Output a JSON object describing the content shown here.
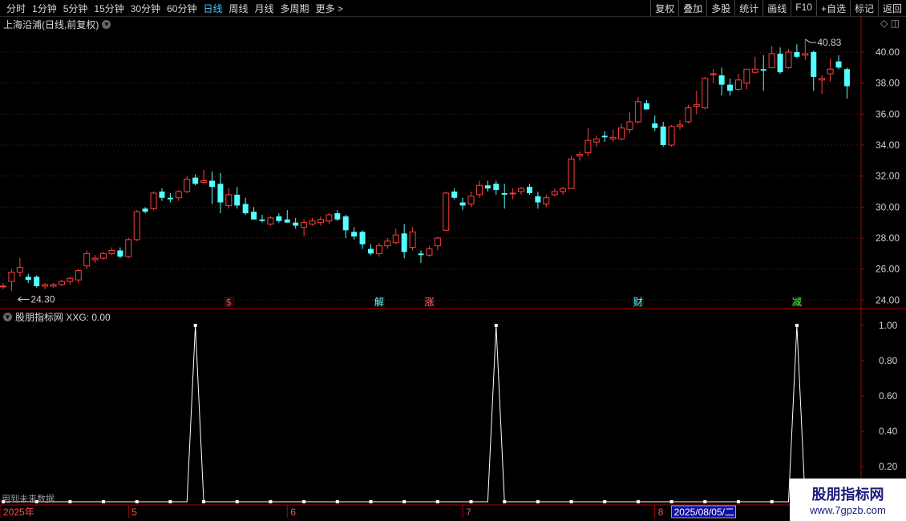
{
  "toolbar": {
    "periods": [
      "分时",
      "1分钟",
      "5分钟",
      "15分钟",
      "30分钟",
      "60分钟",
      "日线",
      "周线",
      "月线",
      "多周期",
      "更多 >"
    ],
    "active_period": "日线",
    "tools": [
      "复权",
      "叠加",
      "多股",
      "统计",
      "画线",
      "F10",
      "+自选",
      "标记",
      "返回"
    ]
  },
  "main_chart": {
    "title": "上海沿浦(日线,前复权)",
    "y_ticks": [
      "40.00",
      "38.00",
      "36.00",
      "34.00",
      "32.00",
      "30.00",
      "28.00",
      "26.00",
      "24.00"
    ],
    "high_label": "40.83",
    "low_label": "24.30",
    "event_marks": [
      "$",
      "解",
      "涨",
      "财",
      "减"
    ],
    "colors": {
      "up": "#ff4040",
      "down": "#54ffff",
      "grid": "#6a1a1a",
      "axis": "#b00000"
    }
  },
  "indicator": {
    "title": "股朋指标网 XXG: 0.00",
    "y_ticks": [
      "1.00",
      "0.80",
      "0.60",
      "0.40",
      "0.20"
    ],
    "future_note": "用到未来数据"
  },
  "date_axis": {
    "labels": [
      "2025年",
      "5",
      "6",
      "7",
      "8"
    ],
    "cursor_date": "2025/08/05/二"
  },
  "watermark": {
    "line1": "股朋指标网",
    "line2": "www.7gpzb.com"
  },
  "chart_data": {
    "type": "candlestick",
    "ylim": [
      23.5,
      41.5
    ],
    "ohlc": [
      [
        24.9,
        25.1,
        24.7,
        24.9
      ],
      [
        25.2,
        26.0,
        24.6,
        25.8
      ],
      [
        25.8,
        26.7,
        25.5,
        26.1
      ],
      [
        25.5,
        25.7,
        25.1,
        25.3
      ],
      [
        25.5,
        25.6,
        24.8,
        24.9
      ],
      [
        24.9,
        25.1,
        24.7,
        25.0
      ],
      [
        24.9,
        25.1,
        24.8,
        25.0
      ],
      [
        25.0,
        25.3,
        24.9,
        25.2
      ],
      [
        25.2,
        25.5,
        25.0,
        25.4
      ],
      [
        25.3,
        26.0,
        25.1,
        25.9
      ],
      [
        26.2,
        27.2,
        26.0,
        27.0
      ],
      [
        26.6,
        26.9,
        26.4,
        26.7
      ],
      [
        26.7,
        27.1,
        26.6,
        27.0
      ],
      [
        27.0,
        27.4,
        26.9,
        27.2
      ],
      [
        27.2,
        27.4,
        26.7,
        26.8
      ],
      [
        26.8,
        28.0,
        26.7,
        27.9
      ],
      [
        27.9,
        29.8,
        27.8,
        29.7
      ],
      [
        29.9,
        30.0,
        29.6,
        29.7
      ],
      [
        29.9,
        31.0,
        29.8,
        30.9
      ],
      [
        31.0,
        31.2,
        30.4,
        30.6
      ],
      [
        30.6,
        30.9,
        30.3,
        30.5
      ],
      [
        30.6,
        31.1,
        30.4,
        31.0
      ],
      [
        31.0,
        32.0,
        30.9,
        31.8
      ],
      [
        31.9,
        32.1,
        31.4,
        31.5
      ],
      [
        31.6,
        32.4,
        31.5,
        31.7
      ],
      [
        31.7,
        32.3,
        30.2,
        31.3
      ],
      [
        31.5,
        32.2,
        29.6,
        30.3
      ],
      [
        30.1,
        31.2,
        29.9,
        30.8
      ],
      [
        30.8,
        31.3,
        29.9,
        30.1
      ],
      [
        30.2,
        30.6,
        29.5,
        29.6
      ],
      [
        29.7,
        30.0,
        29.2,
        29.2
      ],
      [
        29.2,
        29.5,
        29.0,
        29.1
      ],
      [
        28.9,
        29.4,
        28.8,
        29.3
      ],
      [
        29.4,
        29.6,
        29.0,
        29.1
      ],
      [
        29.2,
        29.8,
        29.0,
        29.0
      ],
      [
        29.0,
        29.3,
        28.6,
        28.8
      ],
      [
        28.7,
        29.2,
        28.1,
        29.0
      ],
      [
        28.9,
        29.3,
        28.8,
        29.1
      ],
      [
        29.0,
        29.4,
        28.8,
        29.2
      ],
      [
        29.1,
        29.6,
        28.9,
        29.5
      ],
      [
        29.6,
        29.8,
        29.1,
        29.2
      ],
      [
        29.4,
        29.5,
        28.0,
        28.5
      ],
      [
        28.4,
        28.7,
        27.9,
        28.1
      ],
      [
        28.4,
        28.5,
        27.3,
        27.6
      ],
      [
        27.3,
        27.6,
        26.9,
        27.0
      ],
      [
        27.0,
        27.7,
        26.8,
        27.5
      ],
      [
        27.5,
        28.0,
        27.3,
        27.8
      ],
      [
        27.7,
        28.6,
        27.6,
        28.2
      ],
      [
        28.3,
        28.9,
        26.7,
        27.1
      ],
      [
        27.4,
        28.7,
        27.2,
        28.4
      ],
      [
        27.0,
        27.2,
        26.4,
        26.9
      ],
      [
        26.9,
        27.5,
        26.8,
        27.3
      ],
      [
        27.5,
        28.1,
        27.2,
        28.0
      ],
      [
        28.5,
        31.0,
        28.5,
        30.9
      ],
      [
        31.0,
        31.2,
        30.5,
        30.6
      ],
      [
        30.3,
        30.6,
        29.8,
        30.1
      ],
      [
        30.2,
        31.0,
        30.0,
        30.7
      ],
      [
        30.8,
        31.7,
        30.6,
        31.4
      ],
      [
        31.4,
        31.7,
        31.0,
        31.2
      ],
      [
        31.5,
        31.7,
        30.8,
        31.1
      ],
      [
        30.9,
        31.5,
        29.9,
        30.8
      ],
      [
        30.9,
        31.2,
        30.5,
        30.9
      ],
      [
        31.0,
        31.3,
        30.8,
        31.2
      ],
      [
        31.3,
        31.5,
        30.8,
        30.9
      ],
      [
        30.7,
        31.0,
        29.9,
        30.3
      ],
      [
        30.2,
        30.8,
        30.0,
        30.6
      ],
      [
        30.8,
        31.2,
        30.7,
        31.0
      ],
      [
        31.0,
        31.3,
        30.8,
        31.2
      ],
      [
        31.2,
        33.3,
        31.2,
        33.1
      ],
      [
        33.3,
        33.6,
        33.0,
        33.4
      ],
      [
        33.5,
        35.1,
        33.3,
        34.3
      ],
      [
        34.2,
        34.6,
        33.9,
        34.4
      ],
      [
        34.6,
        34.9,
        34.2,
        34.5
      ],
      [
        34.4,
        35.0,
        34.2,
        34.5
      ],
      [
        34.4,
        35.4,
        34.3,
        35.1
      ],
      [
        35.0,
        36.1,
        34.8,
        35.5
      ],
      [
        35.5,
        37.1,
        35.4,
        36.8
      ],
      [
        36.7,
        36.9,
        36.3,
        36.3
      ],
      [
        35.4,
        35.9,
        34.9,
        35.1
      ],
      [
        35.2,
        35.5,
        33.9,
        34.0
      ],
      [
        34.0,
        35.3,
        33.9,
        35.2
      ],
      [
        35.2,
        35.6,
        35.0,
        35.3
      ],
      [
        35.5,
        36.6,
        35.4,
        36.4
      ],
      [
        36.5,
        37.5,
        36.0,
        36.6
      ],
      [
        36.4,
        38.4,
        36.3,
        38.3
      ],
      [
        38.6,
        38.9,
        38.0,
        38.6
      ],
      [
        38.5,
        39.0,
        37.2,
        37.9
      ],
      [
        37.9,
        38.3,
        37.2,
        37.5
      ],
      [
        37.6,
        38.6,
        37.5,
        38.2
      ],
      [
        38.0,
        38.8,
        37.6,
        38.9
      ],
      [
        38.7,
        39.7,
        38.6,
        38.9
      ],
      [
        38.9,
        39.8,
        37.5,
        38.8
      ],
      [
        39.0,
        40.4,
        39.0,
        39.9
      ],
      [
        39.9,
        40.3,
        38.6,
        38.7
      ],
      [
        39.0,
        40.2,
        38.9,
        40.0
      ],
      [
        40.0,
        40.5,
        39.6,
        39.7
      ],
      [
        39.8,
        40.8,
        39.5,
        39.9
      ],
      [
        40.0,
        40.1,
        37.5,
        38.4
      ],
      [
        38.2,
        38.5,
        37.3,
        38.3
      ],
      [
        38.6,
        39.6,
        38.1,
        38.9
      ],
      [
        39.4,
        39.8,
        38.9,
        39.0
      ],
      [
        38.9,
        39.0,
        37.0,
        37.8
      ]
    ],
    "xxg_signal_indices": [
      23,
      59,
      95
    ]
  }
}
